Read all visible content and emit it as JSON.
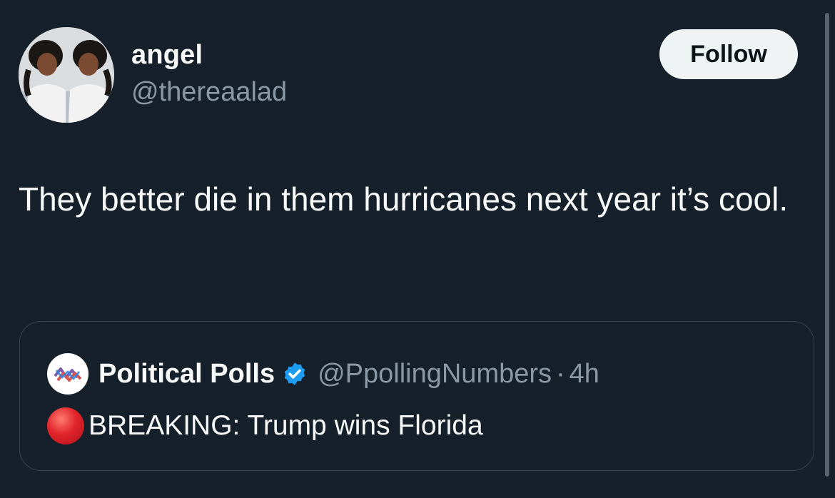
{
  "author": {
    "display_name": "angel",
    "handle": "@thereaalad",
    "avatar_icon": "profile-photo"
  },
  "follow_button": {
    "label": "Follow"
  },
  "tweet": {
    "text": "They better die in them hurricanes next year it’s cool."
  },
  "quoted_tweet": {
    "avatar_icon": "political-polls-logo",
    "display_name": "Political Polls",
    "verified_icon": "verified-badge-icon",
    "handle": "@PpollingNumbers",
    "separator": "·",
    "time": "4h",
    "emoji_icon": "red-circle-icon",
    "text": "BREAKING: Trump wins Florida"
  },
  "colors": {
    "background": "#15202b",
    "primary_text": "#f7f9f9",
    "secondary_text": "#8b98a5",
    "border": "#38444d",
    "verified_blue": "#1d9bf0",
    "follow_bg": "#eff3f4"
  }
}
